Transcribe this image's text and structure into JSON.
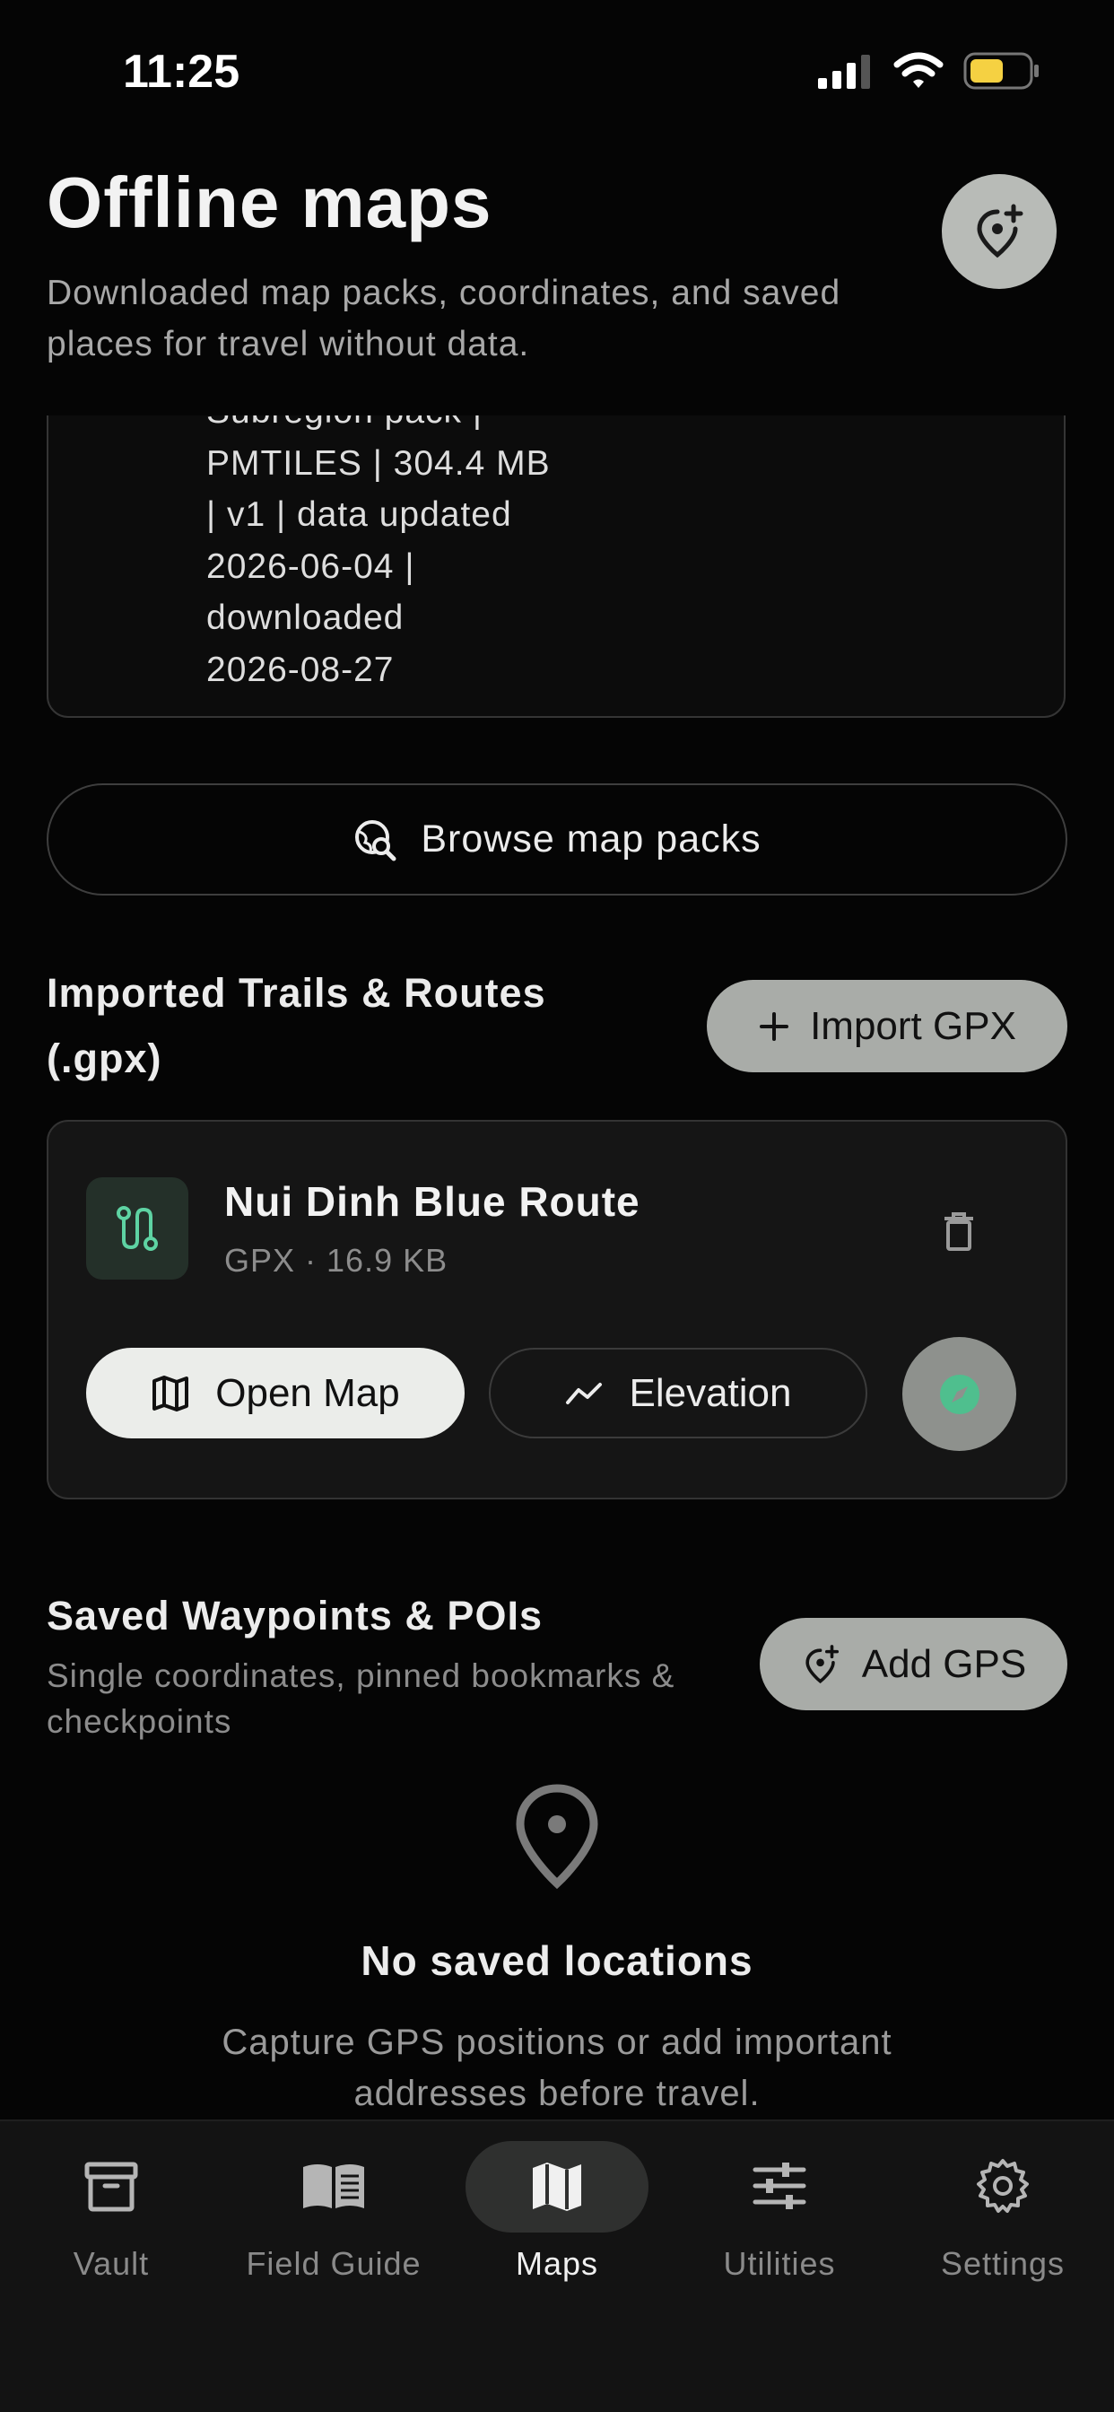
{
  "status_bar": {
    "time": "11:25"
  },
  "header": {
    "title": "Offline maps",
    "subtitle": "Downloaded map packs, coordinates, and saved places for travel without data."
  },
  "map_pack": {
    "detail_lines": [
      "Subregion pack |",
      "PMTILES | 304.4 MB",
      "| v1 | data updated",
      "2026-06-04 |",
      "downloaded",
      "2026-08-27"
    ]
  },
  "browse_button": {
    "label": "Browse map packs"
  },
  "trails_section": {
    "title_line1": "Imported Trails & Routes",
    "title_line2": "(.gpx)",
    "import_label": "Import GPX",
    "trail": {
      "name": "Nui Dinh Blue Route",
      "meta": "GPX · 16.9 KB",
      "open_map_label": "Open Map",
      "elevation_label": "Elevation"
    }
  },
  "waypoints_section": {
    "title": "Saved Waypoints & POIs",
    "subtitle": "Single coordinates, pinned bookmarks & checkpoints",
    "add_label": "Add GPS",
    "empty_title": "No saved locations",
    "empty_desc": "Capture GPS positions or add important addresses before travel."
  },
  "tabs": [
    {
      "label": "Vault",
      "icon": "archive-icon"
    },
    {
      "label": "Field Guide",
      "icon": "book-icon"
    },
    {
      "label": "Maps",
      "icon": "map-icon",
      "active": true
    },
    {
      "label": "Utilities",
      "icon": "sliders-icon"
    },
    {
      "label": "Settings",
      "icon": "gear-icon"
    }
  ],
  "colors": {
    "background": "#050505",
    "accent_green": "#5ed3a3",
    "pill_gray": "#a9aca8",
    "battery_yellow": "#f5d142"
  }
}
